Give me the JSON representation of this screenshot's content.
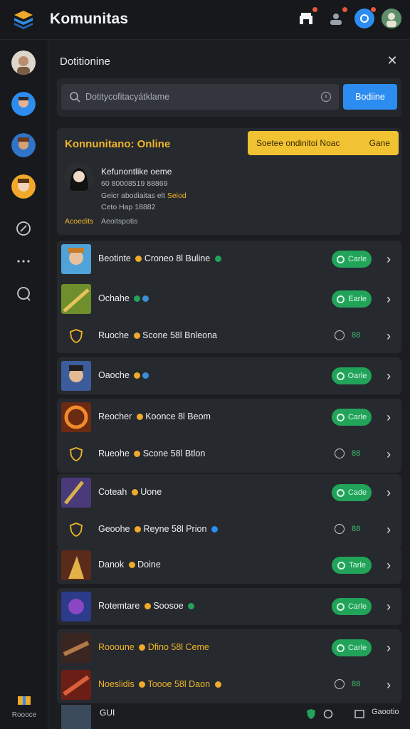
{
  "app": {
    "title": "Komunitas"
  },
  "panel": {
    "title": "Dotitionine",
    "search_placeholder": "Dotitycofitacyátklame",
    "search_button": "Bodiine"
  },
  "community": {
    "title": "Konnunitano: Online",
    "action_label": "Soetee ondinitoi Noac",
    "action_game": "Gane",
    "owner_name": "Kefunontlike oeme",
    "owner_line1": "60 80008519 88869",
    "owner_line2_a": "Geicr abodiaitas elt",
    "owner_line2_b": "Seiod",
    "owner_line3": "Ceto Hap 18882",
    "foot_left": "Acoedits",
    "foot_right": "Aeoitspotis"
  },
  "rows": [
    {
      "label": "Beotinte",
      "suffix": "Croneo 8l Buline",
      "action": "Carle"
    },
    {
      "label": "Ochahe",
      "suffix": "",
      "action": "Earle"
    },
    {
      "label": "Ruoche",
      "suffix": "Scone 58l Bnleona",
      "count": "88"
    },
    {
      "label": "Oaoche",
      "suffix": "",
      "action": "Oarle"
    },
    {
      "label": "Reocher",
      "suffix": "Koonce 8l Beom",
      "action": "Carle"
    },
    {
      "label": "Rueohe",
      "suffix": "Scone 58l Btlon",
      "count": "88"
    },
    {
      "label": "Coteah",
      "suffix": "Uone",
      "action": "Cade"
    },
    {
      "label": "Geoohe",
      "suffix": "Reyne 58l Prion",
      "count": "88"
    },
    {
      "label": "Danok",
      "suffix": "Doine",
      "action": "Tarle"
    },
    {
      "label": "Rotemtare",
      "suffix": "Soosoe",
      "action": "Carle"
    },
    {
      "label": "Roooune",
      "suffix": "Dfino 58l Ceme",
      "action": "Carle"
    },
    {
      "label": "Noeslidis",
      "suffix": "Toooe 58l Daon",
      "count": "88"
    }
  ],
  "bottom": {
    "label": "GUI",
    "right": "Gaootio"
  },
  "sidebar": {
    "bottom_label": "Roooce"
  },
  "colors": {
    "accent_blue": "#2d8cf0",
    "accent_green": "#22a35a",
    "accent_gold": "#f1c232"
  }
}
